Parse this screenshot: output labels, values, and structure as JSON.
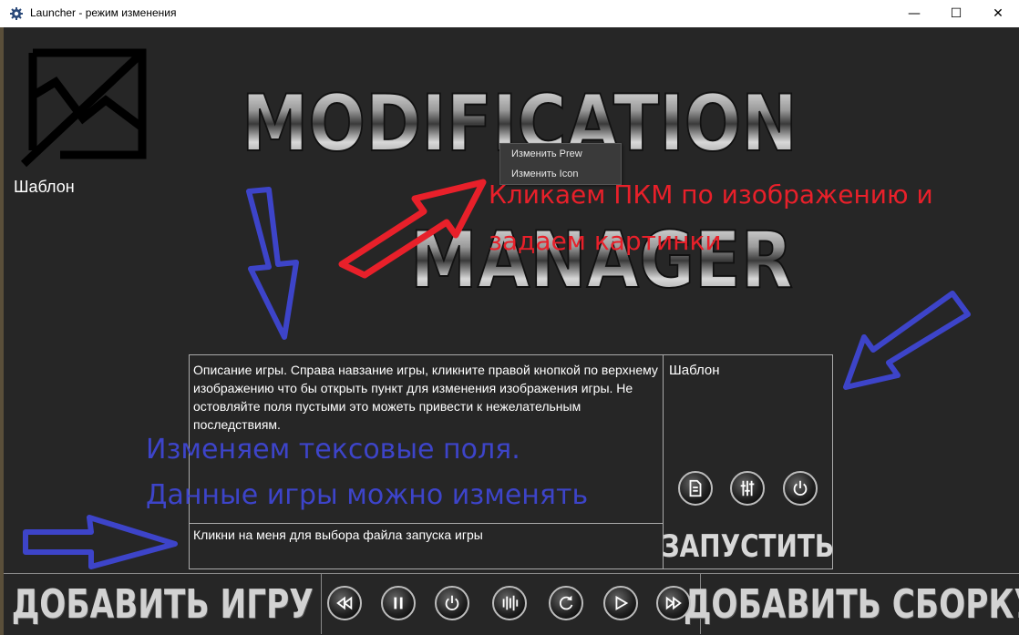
{
  "window": {
    "title": "Launcher - режим изменения",
    "minimize_glyph": "—",
    "maximize_glyph": "☐",
    "close_glyph": "✕"
  },
  "game": {
    "title": "Шаблон",
    "name_field": "Шаблон",
    "description": "Описание игры. Справа навзание игры, кликните правой кнопкой по верхнему изображению что бы открыть пункт для изменения изображения игры. Не остовляйте поля пустыми это можеть привести к нежелательным последствиям.",
    "exe_field": "Кликни на меня для выбора файла запуска игры",
    "launch_label": "ЗАПУСТИТЬ"
  },
  "banner": {
    "line1": "MODIFICATION",
    "line2": "MANAGER"
  },
  "context_menu": {
    "items": [
      "Изменить Prew",
      "Изменить Icon"
    ]
  },
  "annotations": {
    "red_line1": "Кликаем ПКМ по изображению и",
    "red_line2": "задаем картинки",
    "blue_line1": "Изменяем тексовые поля.",
    "blue_line2": "Данные игры можно изменять"
  },
  "game_buttons": {
    "icons": [
      "document-icon",
      "equalizer-icon",
      "power-icon"
    ]
  },
  "bottom": {
    "add_game": "ДОБАВИТЬ ИГРУ",
    "add_build": "ДОБАВИТЬ СБОРКУ",
    "media_icons": [
      "rewind-icon",
      "pause-icon",
      "power-icon",
      "equalizer-icon",
      "refresh-icon",
      "play-icon",
      "fast-forward-icon"
    ]
  },
  "colors": {
    "background": "#262626",
    "annotation_red": "#e8202a",
    "annotation_blue": "#3d44c9"
  }
}
